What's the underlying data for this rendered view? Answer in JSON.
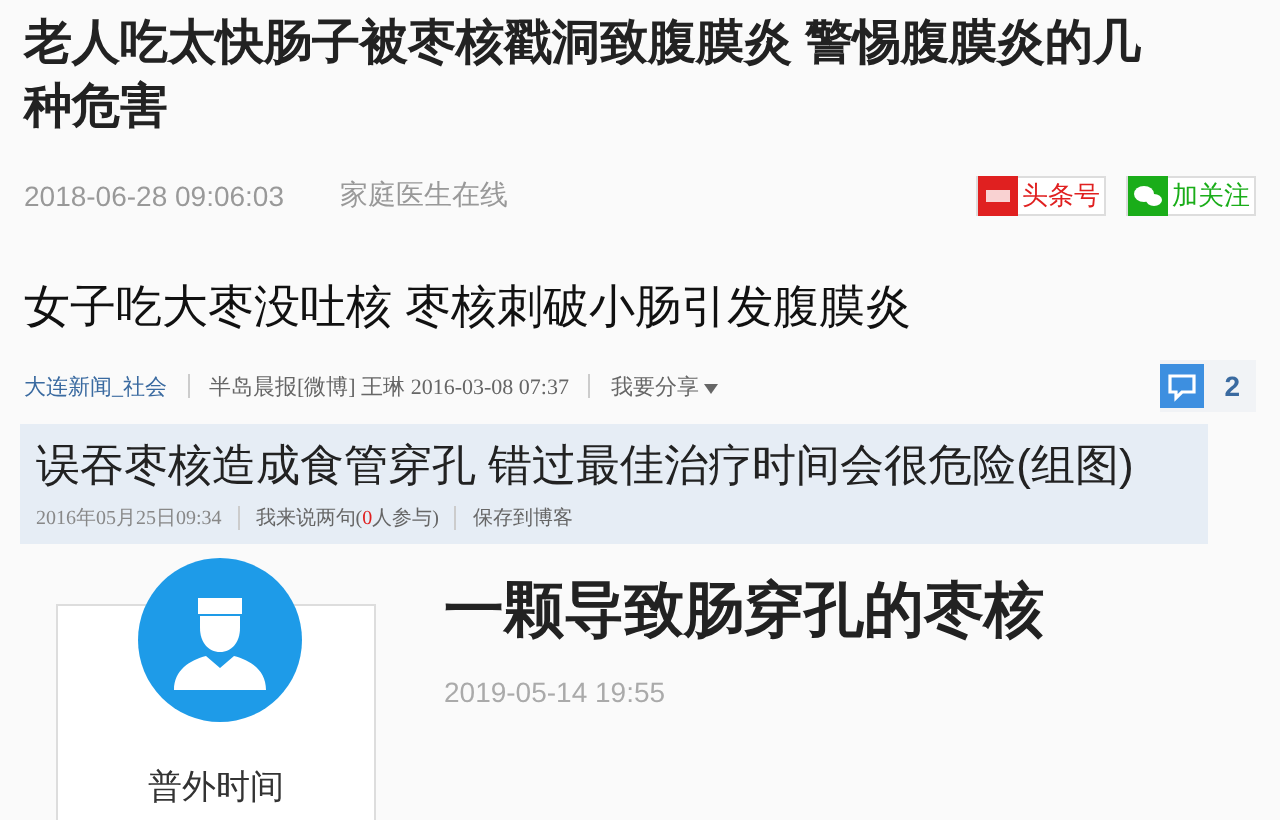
{
  "article_1": {
    "headline": "老人吃太快肠子被枣核戳洞致腹膜炎 警惕腹膜炎的几种危害",
    "timestamp": "2018-06-28 09:06:03",
    "source": "家庭医生在线",
    "buttons": [
      {
        "kind": "toutiao",
        "label": "头条号"
      },
      {
        "kind": "wechat",
        "label": "加关注"
      }
    ]
  },
  "article_2": {
    "headline": "女子吃大枣没吐核 枣核刺破小肠引发腹膜炎",
    "meta": [
      {
        "kind": "link",
        "text": "大连新闻_社会"
      },
      {
        "kind": "text",
        "text": "半岛晨报[微博]  王琳   2016-03-08 07:37"
      },
      {
        "kind": "share",
        "text": "我要分享"
      }
    ],
    "comment_count": "2"
  },
  "article_3": {
    "headline": "误吞枣核造成食管穿孔 错过最佳治疗时间会很危险(组图)",
    "date": "2016年05月25日09:34",
    "comment_link": {
      "before": "我来说两句(",
      "count": "0",
      "after": "人参与)"
    },
    "save_link": "保存到博客"
  },
  "article_4": {
    "headline": "一颗导致肠穿孔的枣核",
    "date": "2019-05-14 19:55",
    "author": "普外时间"
  }
}
